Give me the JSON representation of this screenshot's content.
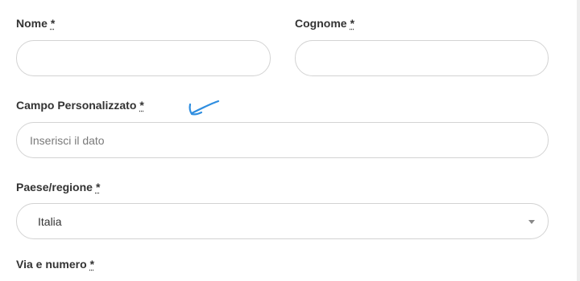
{
  "form": {
    "required_marker": "*",
    "first_name": {
      "label": "Nome",
      "value": "",
      "placeholder": ""
    },
    "last_name": {
      "label": "Cognome",
      "value": "",
      "placeholder": ""
    },
    "custom_field": {
      "label": "Campo Personalizzato",
      "value": "",
      "placeholder": "Inserisci il dato"
    },
    "country": {
      "label": "Paese/regione",
      "selected": "Italia"
    },
    "street": {
      "label": "Via e numero"
    }
  },
  "annotation": {
    "icon": "hand-drawn-arrow-icon",
    "color": "#2f8ee0"
  }
}
